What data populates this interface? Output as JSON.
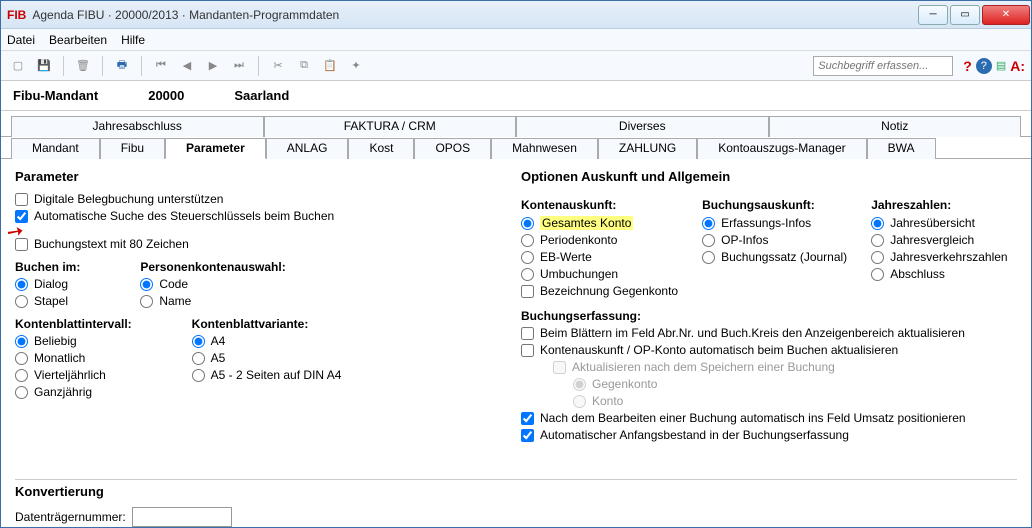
{
  "window": {
    "app_icon": "FIB",
    "title": "Agenda FIBU · 20000/2013 · Mandanten-Programmdaten"
  },
  "menu": {
    "datei": "Datei",
    "bearbeiten": "Bearbeiten",
    "hilfe": "Hilfe"
  },
  "toolbar": {
    "search_placeholder": "Suchbegriff erfassen..."
  },
  "client": {
    "label": "Fibu-Mandant",
    "number": "20000",
    "name": "Saarland"
  },
  "tabs_upper": [
    "Jahresabschluss",
    "FAKTURA / CRM",
    "Diverses",
    "Notiz"
  ],
  "tabs_lower": [
    "Mandant",
    "Fibu",
    "Parameter",
    "ANLAG",
    "Kost",
    "OPOS",
    "Mahnwesen",
    "ZAHLUNG",
    "Kontoauszugs-Manager",
    "BWA"
  ],
  "param": {
    "title": "Parameter",
    "chk_digital": "Digitale Belegbuchung unterstützen",
    "chk_autosteuer": "Automatische Suche des Steuerschlüssels beim Buchen",
    "chk_buchungstext": "Buchungstext mit 80 Zeichen",
    "buchen_im": "Buchen im:",
    "dialog": "Dialog",
    "stapel": "Stapel",
    "personen": "Personenkontenauswahl:",
    "code": "Code",
    "name": "Name",
    "kbi": "Kontenblattintervall:",
    "beliebig": "Beliebig",
    "monatlich": "Monatlich",
    "viertel": "Vierteljährlich",
    "ganz": "Ganzjährig",
    "kbv": "Kontenblattvariante:",
    "a4": "A4",
    "a5": "A5",
    "a5din": "A5 - 2 Seiten auf DIN A4"
  },
  "opt": {
    "title": "Optionen Auskunft und Allgemein",
    "konten_h": "Kontenauskunft:",
    "gesamtes": "Gesamtes Konto",
    "periodenkonto": "Periodenkonto",
    "ebwerte": "EB-Werte",
    "umbuchungen": "Umbuchungen",
    "bez_gegen": "Bezeichnung Gegenkonto",
    "buch_h": "Buchungsauskunft:",
    "erfassung": "Erfassungs-Infos",
    "opinfos": "OP-Infos",
    "buchungssatz": "Buchungssatz (Journal)",
    "jahr_h": "Jahreszahlen:",
    "jahresueber": "Jahresübersicht",
    "jahresvergleich": "Jahresvergleich",
    "jahresverkehr": "Jahresverkehrszahlen",
    "abschluss": "Abschluss",
    "buchungserf": "Buchungserfassung:",
    "blaettern": "Beim Blättern im Feld Abr.Nr. und Buch.Kreis den  Anzeigenbereich aktualisieren",
    "kontenauskunft_auto": "Kontenauskunft / OP-Konto automatisch beim Buchen aktualisieren",
    "aktualisieren_nach": "Aktualisieren nach dem Speichern einer Buchung",
    "gegenkonto": "Gegenkonto",
    "konto": "Konto",
    "nach_bearb": "Nach dem Bearbeiten einer Buchung automatisch ins Feld Umsatz positionieren",
    "auto_anfang": "Automatischer Anfangsbestand in der Buchungserfassung"
  },
  "konv": {
    "title": "Konvertierung",
    "daten": "Datenträgernummer:"
  }
}
